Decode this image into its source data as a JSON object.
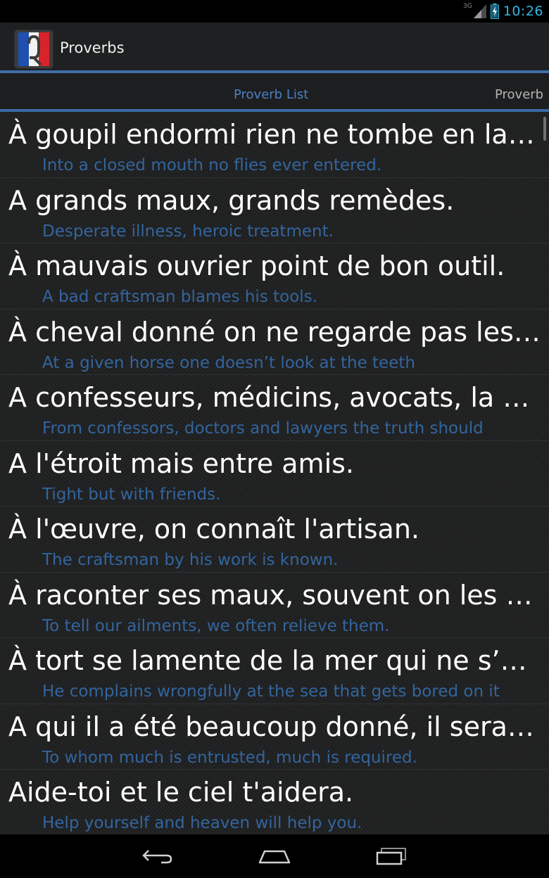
{
  "status_bar": {
    "network_label": "3G",
    "clock": "10:26",
    "icons": [
      "signal-icon",
      "battery-icon"
    ]
  },
  "action_bar": {
    "app_title": "Proverbs",
    "app_icon": "french-flag-q-icon"
  },
  "tabs": [
    {
      "label": "Proverb List",
      "active": true
    },
    {
      "label": "Proverb",
      "active": false
    }
  ],
  "colors": {
    "accent_blue": "#33b5e5",
    "divider_blue": "#3d6ea8",
    "active_tab_text": "#4b80c4",
    "translation_text": "#33659e",
    "item_text": "#ffffff",
    "status_bar_bg": "#000000"
  },
  "proverbs": [
    {
      "french": "À goupil endormi rien ne tombe en la g…",
      "english": "Into a closed mouth no flies ever entered."
    },
    {
      "french": "A grands maux, grands remèdes.",
      "english": "Desperate illness, heroic treatment."
    },
    {
      "french": "À mauvais ouvrier point de bon outil.",
      "english": "A bad craftsman blames his tools."
    },
    {
      "french": "À cheval donné on ne regarde pas les d…",
      "english": "At a given horse one doesn’t look at the teeth"
    },
    {
      "french": "A confesseurs, médicins, avocats, la vé…",
      "english": "From confessors, doctors and lawyers the truth should"
    },
    {
      "french": "A l'étroit mais entre amis.",
      "english": "Tight but with friends."
    },
    {
      "french": "À l'œuvre, on connaît l'artisan.",
      "english": "The craftsman by his work is known."
    },
    {
      "french": "À raconter ses maux, souvent on les so…",
      "english": "To tell our ailments, we often relieve them."
    },
    {
      "french": "À tort se lamente de la mer qui ne s’en…",
      "english": "He complains wrongfully at the sea that gets bored on it"
    },
    {
      "french": "A qui il a été beaucoup donné, il sera b…",
      "english": "To whom much is entrusted, much is required."
    },
    {
      "french": "Aide-toi et le ciel t'aidera.",
      "english": "Help yourself and heaven will help you."
    }
  ],
  "nav_bar": {
    "buttons": [
      "back-icon",
      "home-icon",
      "recents-icon"
    ]
  }
}
